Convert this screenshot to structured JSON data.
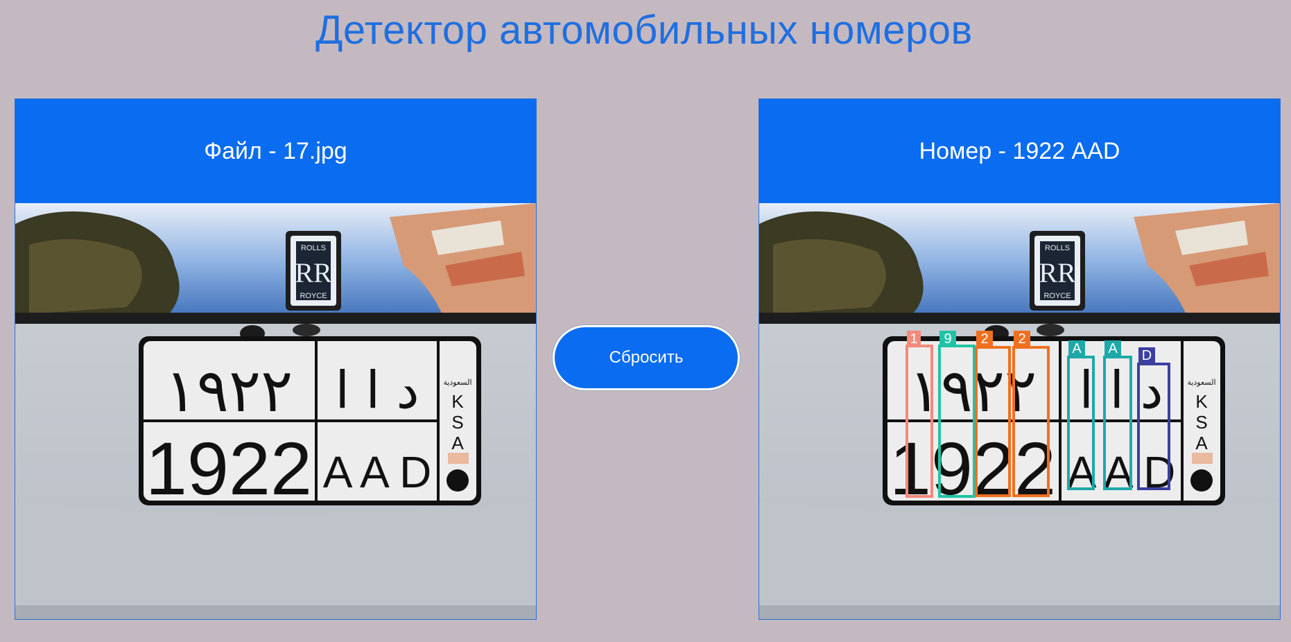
{
  "page": {
    "title": "Детектор автомобильных номеров"
  },
  "left_panel": {
    "heading": "Файл - 17.jpg"
  },
  "right_panel": {
    "heading": "Номер - 1922 AAD"
  },
  "reset_button": {
    "label": "Сбросить"
  },
  "photo": {
    "badge_text": [
      "ROLLS",
      "RR",
      "ROYCE"
    ],
    "plate_top_arabic_digits": "١٩٢٢",
    "plate_top_arabic_letters": "د ا ا",
    "plate_bottom_digits": "1922",
    "plate_bottom_letters": "A A D",
    "country_arabic": "السعودية",
    "country_code": [
      "K",
      "S",
      "A"
    ]
  },
  "detections": [
    {
      "label": "1",
      "color": "#f28a7a"
    },
    {
      "label": "9",
      "color": "#1fc4a6"
    },
    {
      "label": "2",
      "color": "#f07020"
    },
    {
      "label": "2",
      "color": "#f07020"
    },
    {
      "label": "A",
      "color": "#1fa8a8"
    },
    {
      "label": "A",
      "color": "#1fa8a8"
    },
    {
      "label": "D",
      "color": "#3a3fa0"
    }
  ],
  "colors": {
    "background": "#c5b9c1",
    "accent": "#0a6cf0",
    "title": "#1f6fe0"
  }
}
